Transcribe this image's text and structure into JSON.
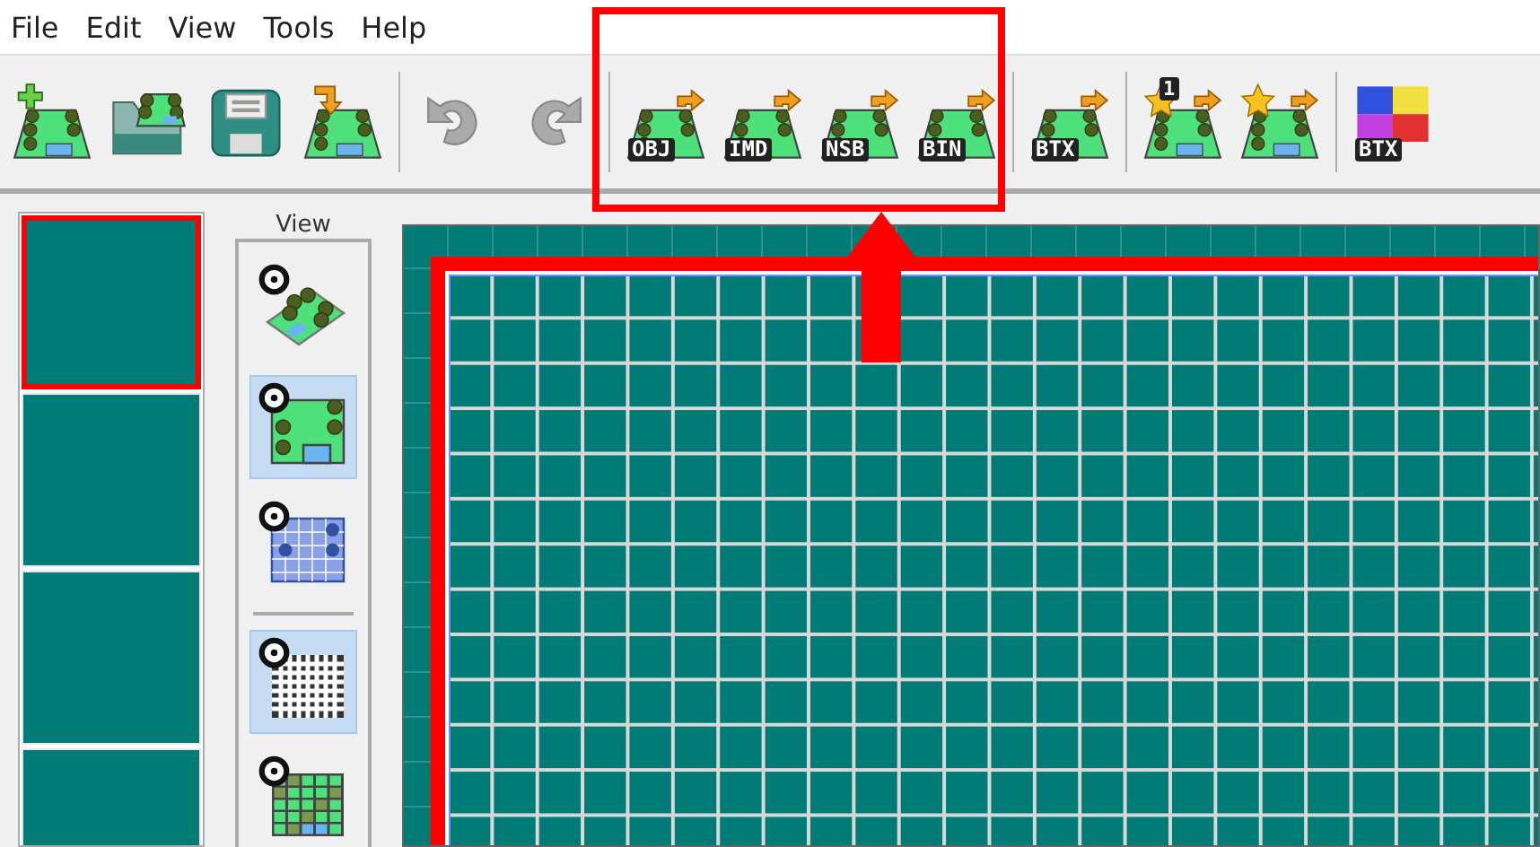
{
  "menu": [
    "File",
    "Edit",
    "View",
    "Tools",
    "Help"
  ],
  "toolbar": {
    "groups": [
      {
        "highlighted": false,
        "buttons": [
          {
            "kind": "new"
          },
          {
            "kind": "open"
          },
          {
            "kind": "save"
          },
          {
            "kind": "import"
          }
        ]
      },
      {
        "highlighted": false,
        "buttons": [
          {
            "kind": "undo"
          },
          {
            "kind": "redo"
          }
        ]
      },
      {
        "highlighted": true,
        "buttons": [
          {
            "kind": "export",
            "label": "OBJ"
          },
          {
            "kind": "export",
            "label": "IMD"
          },
          {
            "kind": "export",
            "label": "NSB"
          },
          {
            "kind": "export",
            "label": "BIN"
          }
        ]
      },
      {
        "highlighted": false,
        "buttons": [
          {
            "kind": "export",
            "label": "BTX"
          }
        ]
      },
      {
        "highlighted": false,
        "buttons": [
          {
            "kind": "star",
            "label": "1"
          },
          {
            "kind": "star"
          }
        ]
      },
      {
        "highlighted": false,
        "buttons": [
          {
            "kind": "texture",
            "label": "BTX"
          }
        ]
      }
    ]
  },
  "tiles": [
    {
      "selected": true
    },
    {
      "selected": false
    },
    {
      "selected": false
    },
    {
      "selected": false
    }
  ],
  "view": {
    "label": "View",
    "groups": [
      [
        {
          "kind": "perspective",
          "selected": false
        },
        {
          "kind": "top",
          "selected": true
        },
        {
          "kind": "collision",
          "selected": false
        }
      ],
      [
        {
          "kind": "grid",
          "selected": true
        },
        {
          "kind": "tiles",
          "selected": false
        }
      ]
    ]
  },
  "map": {
    "highlighted": true
  },
  "annotation": {
    "kind": "up-arrow"
  }
}
